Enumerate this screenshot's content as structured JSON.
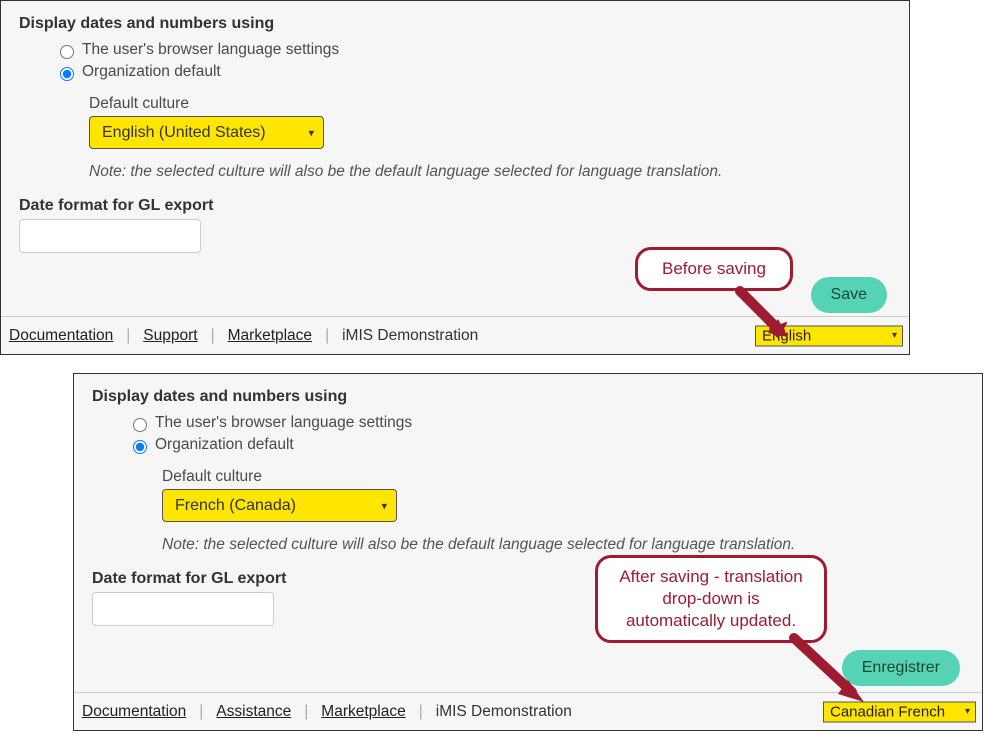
{
  "before": {
    "heading": "Display dates and numbers using",
    "radio1": "The user's browser language settings",
    "radio2": "Organization default",
    "culture_label": "Default culture",
    "culture_value": "English (United States)",
    "note": "Note: the selected culture will also be the default language selected for language translation.",
    "gl_label": "Date format for GL export",
    "save": "Save",
    "footer": {
      "doc": "Documentation",
      "support": "Support",
      "marketplace": "Marketplace",
      "demo": "iMIS Demonstration",
      "lang": "English"
    },
    "callout": "Before saving"
  },
  "after": {
    "heading": "Display dates and numbers using",
    "radio1": "The user's browser language settings",
    "radio2": "Organization default",
    "culture_label": "Default culture",
    "culture_value": "French (Canada)",
    "note": "Note: the selected culture will also be the default language selected for language translation.",
    "gl_label": "Date format for GL export",
    "save": "Enregistrer",
    "footer": {
      "doc": "Documentation",
      "support": "Assistance",
      "marketplace": "Marketplace",
      "demo": "iMIS Demonstration",
      "lang": "Canadian French"
    },
    "callout": "After saving - translation drop-down is automatically updated."
  }
}
